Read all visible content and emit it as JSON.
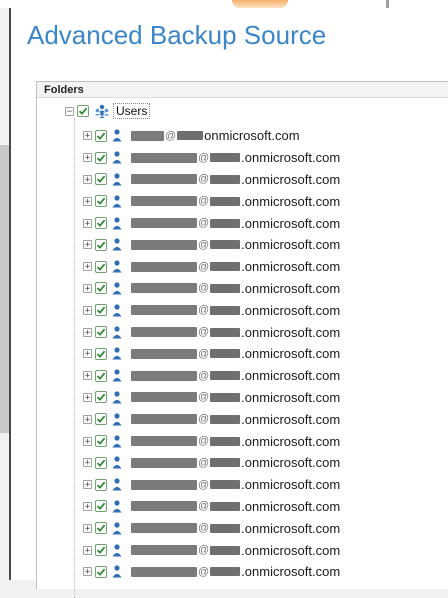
{
  "dialog": {
    "title": "Advanced Backup Source"
  },
  "panel": {
    "header_label": "Folders",
    "root": {
      "label": "Users",
      "checked": true,
      "expanded": true
    },
    "email_suffix": ".onmicrosoft.com",
    "first_email_suffix": "onmicrosoft.com",
    "at_sign": "@",
    "user_count": 21
  },
  "colors": {
    "title": "#3a86c8",
    "check": "#2e8b2e",
    "user_icon": "#2f6fb5"
  },
  "icons": {
    "expander": "plus-box",
    "root_icon": "users-group-icon",
    "row_icon": "user-icon"
  }
}
